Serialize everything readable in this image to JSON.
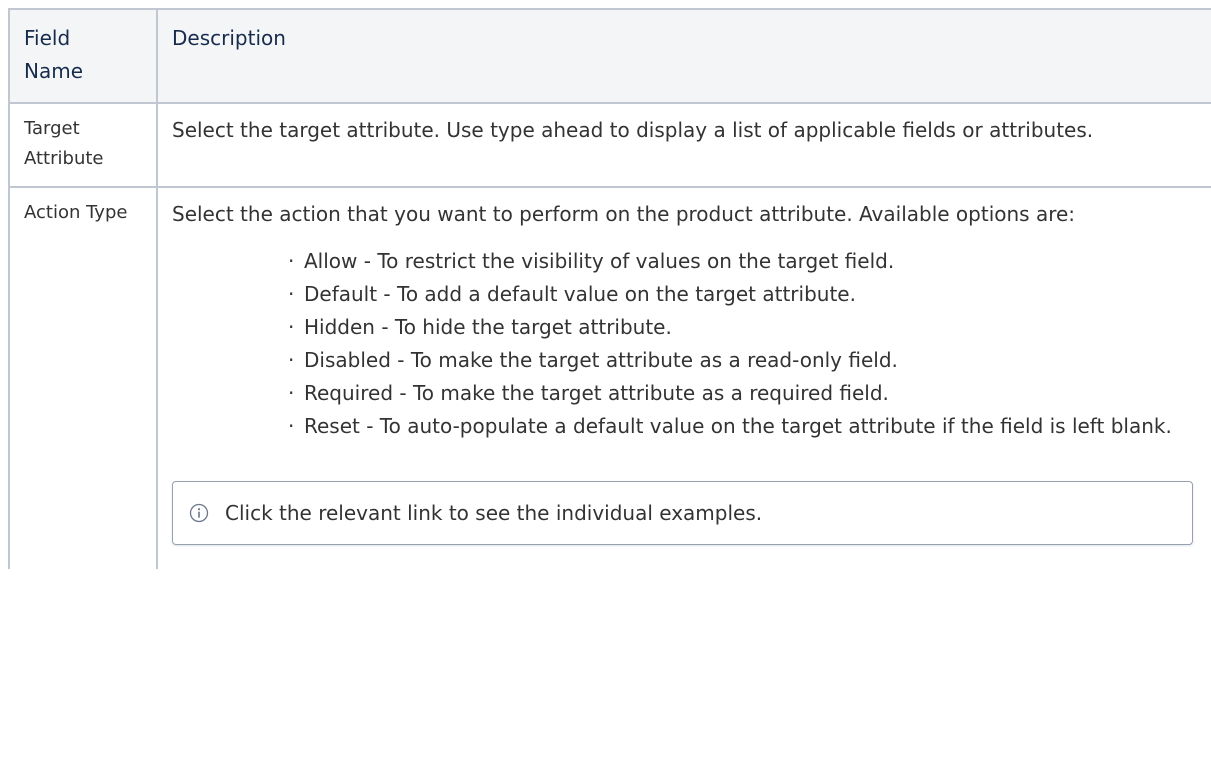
{
  "table": {
    "headers": {
      "field_name": "Field\nName",
      "description": "Description"
    },
    "rows": [
      {
        "field_name": "Target Attribute",
        "description": "Select the target attribute. Use type ahead to display a list of applicable fields or attributes."
      },
      {
        "field_name": "Action Type",
        "description": "Select the action that you want to perform on the product attribute. Available options are:",
        "options": [
          "Allow - To restrict the visibility of values on the target field.",
          "Default - To add a default value on the target attribute.",
          "Hidden - To hide the target attribute.",
          "Disabled - To make the target attribute as a read-only field.",
          "Required - To make the target attribute as a required field.",
          "Reset - To auto-populate a default value on the target attribute if the field is left blank."
        ],
        "info_panel": {
          "icon": "info-icon",
          "text": "Click the relevant link to see the individual examples."
        }
      }
    ]
  }
}
